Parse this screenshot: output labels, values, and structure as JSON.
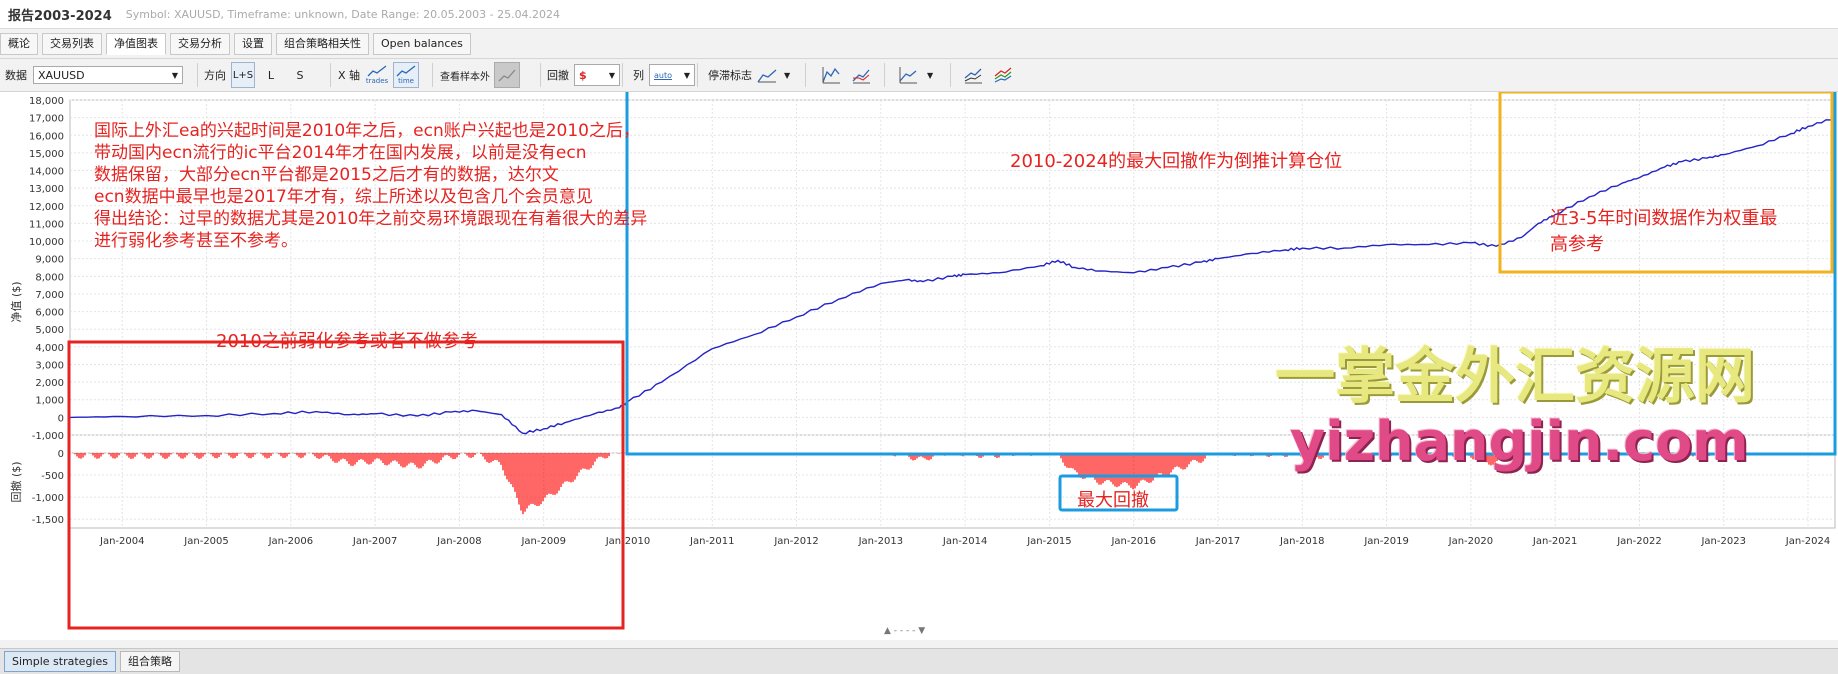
{
  "window": {
    "title": "报告2003-2024",
    "meta": "Symbol: XAUUSD, Timeframe: unknown, Date Range: 20.05.2003 - 25.04.2024"
  },
  "tabs": [
    "概论",
    "交易列表",
    "净值图表",
    "交易分析",
    "设置",
    "组合策略相关性",
    "Open balances"
  ],
  "active_tab": "净值图表",
  "toolbar": {
    "data_label": "数据",
    "data_value": "XAUUSD",
    "direction_label": "方向",
    "direction_options": [
      "L+S",
      "L",
      "S"
    ],
    "xaxis_label": "X 轴",
    "xaxis_options": [
      "trades",
      "time"
    ],
    "insample_label": "查看样本外",
    "drawdown_label": "回撤",
    "drawdown_icon": "$",
    "columns_label": "列",
    "columns_value": "auto",
    "stagnation_label": "停滞标志",
    "icons": [
      "equity-line-icon",
      "equity-compare-icon",
      "trend-line-icon",
      "multi-series-icon",
      "multi-color-series-icon"
    ]
  },
  "chart_data": {
    "type": "line",
    "ylabel": "净值 ($)",
    "ylabel_drawdown": "回撤 ($)",
    "y_ticks": [
      "18,000",
      "17,000",
      "16,000",
      "15,000",
      "14,000",
      "13,000",
      "12,000",
      "11,000",
      "10,000",
      "9,000",
      "8,000",
      "7,000",
      "6,000",
      "5,000",
      "4,000",
      "3,000",
      "2,000",
      "1,000",
      "0",
      "-1,000"
    ],
    "ylim": [
      -1000,
      18000
    ],
    "dd_ticks": [
      "0",
      "-500",
      "-1,000",
      "-1,500"
    ],
    "dd_ylim": [
      -1700,
      0
    ],
    "x_ticks": [
      "Jan-2004",
      "Jan-2005",
      "Jan-2006",
      "Jan-2007",
      "Jan-2008",
      "Jan-2009",
      "Jan-2010",
      "Jan-2011",
      "Jan-2012",
      "Jan-2013",
      "Jan-2014",
      "Jan-2015",
      "Jan-2016",
      "Jan-2017",
      "Jan-2018",
      "Jan-2019",
      "Jan-2020",
      "Jan-2021",
      "Jan-2022",
      "Jan-2023",
      "Jan-2024"
    ],
    "xlim": [
      2003.38,
      2024.32
    ],
    "line_color": "#2323c8",
    "dd_color": "#ff0000",
    "series": [
      {
        "x": [
          2003.38,
          2004.0,
          2005.0,
          2005.8,
          2006.3,
          2006.7,
          2007.0,
          2007.5,
          2007.9,
          2008.2,
          2008.5,
          2008.75,
          2009.0,
          2009.25,
          2009.6,
          2009.9,
          2010.0,
          2010.4,
          2011.0,
          2011.5,
          2012.0,
          2012.5,
          2013.0,
          2013.3,
          2013.5,
          2013.85,
          2014.0,
          2014.4,
          2014.9,
          2015.1,
          2015.3,
          2015.6,
          2016.0,
          2016.4,
          2016.8,
          2017.0,
          2017.4,
          2017.8,
          2018.0,
          2018.5,
          2019.0,
          2019.5,
          2020.0,
          2020.3,
          2020.6,
          2020.8,
          2021.0,
          2021.4,
          2021.8,
          2022.0,
          2022.3,
          2022.5,
          2022.8,
          2023.0,
          2023.4,
          2023.8,
          2024.0,
          2024.32
        ],
        "y": [
          0,
          50,
          100,
          220,
          330,
          150,
          200,
          80,
          300,
          380,
          150,
          -900,
          -650,
          -300,
          200,
          550,
          900,
          2000,
          3900,
          4700,
          5700,
          6700,
          7600,
          7800,
          7700,
          8000,
          8100,
          8200,
          8600,
          8900,
          8500,
          8300,
          8200,
          8500,
          8800,
          9000,
          9300,
          9500,
          9600,
          9600,
          9800,
          9800,
          9900,
          9700,
          10200,
          11000,
          11500,
          12500,
          13300,
          13600,
          14200,
          14500,
          14700,
          14900,
          15400,
          16100,
          16500,
          17000
        ]
      }
    ]
  },
  "annotations": {
    "left_text": [
      "国际上外汇ea的兴起时间是2010年之后，ecn账户兴起也是2010之后，",
      "带动国内ecn流行的ic平台2014年才在国内发展，以前是没有ecn",
      "数据保留，大部分ecn平台都是2015之后才有的数据，达尔文",
      "ecn数据中最早也是2017年才有，综上所述以及包含几个会员意见",
      "得出结论：过早的数据尤其是2010年之前交易环境跟现在有着很大的差异",
      "进行弱化参考甚至不参考。"
    ],
    "pre2010": "2010之前弱化参考或者不做参考",
    "middle": "2010-2024的最大回撤作为倒推计算仓位",
    "recent": [
      "近3-5年时间数据作为权重最",
      "高参考"
    ],
    "max_dd": "最大回撤",
    "watermark_cn": "一掌金外汇资源网",
    "watermark_url": "yizhangjin.com"
  },
  "bottom_tabs": [
    "Simple strategies",
    "组合策略"
  ],
  "collapse_handle": "▲ - - - - ▼"
}
